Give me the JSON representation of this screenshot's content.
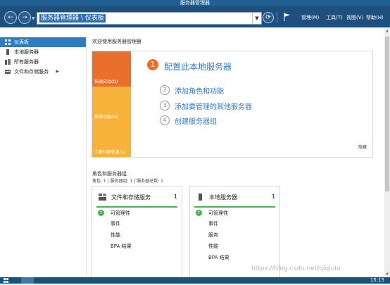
{
  "window": {
    "title": "服务器管理器"
  },
  "nav": {
    "back_label": "←",
    "forward_label": "→",
    "address": "服务器管理器 \\ 仪表板",
    "menus": [
      {
        "label": "管理(M)"
      },
      {
        "label": "工具(T)"
      },
      {
        "label": "视图(V)"
      },
      {
        "label": "帮助(H)"
      }
    ]
  },
  "sidebar": {
    "items": [
      {
        "label": "仪表板",
        "active": true,
        "icon": "dashboard-icon"
      },
      {
        "label": "本地服务器",
        "active": false,
        "icon": "server-icon"
      },
      {
        "label": "所有服务器",
        "active": false,
        "icon": "servers-icon"
      },
      {
        "label": "文件和存储服务",
        "active": false,
        "icon": "storage-icon",
        "expandable": true
      }
    ]
  },
  "welcome": {
    "title": "欢迎使用服务器管理器",
    "tiles": [
      {
        "label": "快速启动(Q)",
        "color": "#e8702a"
      },
      {
        "label": "新增功能(W)",
        "color": "#f7b23b"
      },
      {
        "label": "了解详细信息(L)",
        "color": "#f7b23b"
      }
    ],
    "steps": [
      {
        "number": "1",
        "text": "配置此本地服务器"
      },
      {
        "number": "2",
        "text": "添加角色和功能"
      },
      {
        "number": "3",
        "text": "添加要管理的其他服务器"
      },
      {
        "number": "4",
        "text": "创建服务器组"
      }
    ],
    "hide_label": "隐藏"
  },
  "roles": {
    "title": "角色和服务器组",
    "subtitle": "角色: 1 | 服务器组: 1 | 服务器总数: 1",
    "cards": [
      {
        "title": "文件和存储服务",
        "count": "1",
        "status": "可管理性",
        "rows": [
          "事件",
          "性能",
          "BPA 结果"
        ],
        "icon": "storage-icon"
      },
      {
        "title": "本地服务器",
        "count": "1",
        "status": "可管理性",
        "rows": [
          "事件",
          "服务",
          "性能",
          "BPA 结果"
        ],
        "icon": "server-icon"
      }
    ]
  },
  "taskbar": {
    "clock": "15:15"
  },
  "watermark": "https://blog.csdn.net/qlqlulu",
  "colors": {
    "accent": "#2f7bc4",
    "orange": "#e8702a",
    "amber": "#f7b23b",
    "ok": "#4caf50",
    "navbar": "#1f4f7d"
  }
}
